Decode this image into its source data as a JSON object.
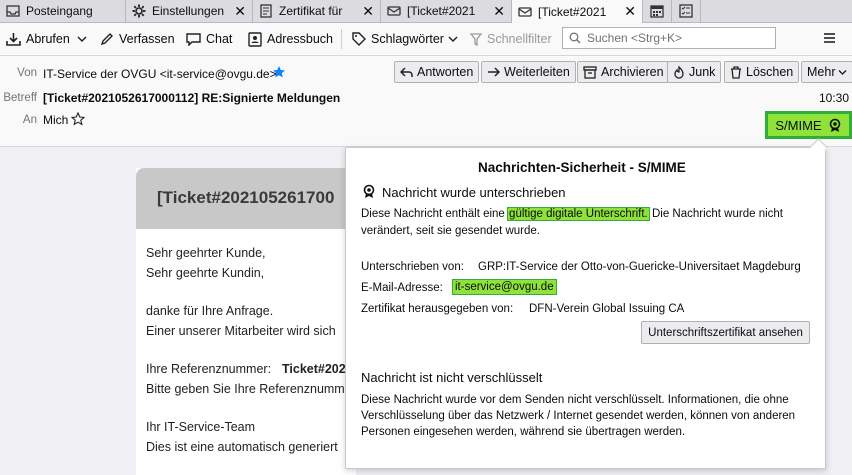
{
  "tabs": [
    {
      "label": "Posteingang",
      "icon": "inbox-icon"
    },
    {
      "label": "Einstellungen",
      "icon": "gear-icon"
    },
    {
      "label": "Zertifikat für",
      "icon": "document-icon"
    },
    {
      "label": "[Ticket#2021",
      "icon": "envelope-icon"
    },
    {
      "label": "[Ticket#2021",
      "icon": "envelope-icon"
    }
  ],
  "toolbar": {
    "abrufen": "Abrufen",
    "verfassen": "Verfassen",
    "chat": "Chat",
    "adressbuch": "Adressbuch",
    "schlagwoerter": "Schlagwörter",
    "schnellfilter": "Schnellfilter",
    "search_placeholder": "Suchen <Strg+K>",
    "menu_icon": "hamburger-icon"
  },
  "header": {
    "von_label": "Von",
    "von_value": "IT-Service der OVGU <it-service@ovgu.de>",
    "betreff_label": "Betreff",
    "betreff_value": "[Ticket#2021052617000112] RE:Signierte Meldungen",
    "an_label": "An",
    "an_value": "Mich",
    "time": "10:30",
    "buttons": {
      "antworten": "Antworten",
      "weiterleiten": "Weiterleiten",
      "archivieren": "Archivieren",
      "junk": "Junk",
      "loeschen": "Löschen",
      "mehr": "Mehr"
    },
    "smime": "S/MIME"
  },
  "message": {
    "title": "[Ticket#202105261700",
    "lines": [
      "Sehr geehrter Kunde,",
      "Sehr geehrte Kundin,",
      "danke für Ihre Anfrage.",
      "Einer unserer Mitarbeiter wird sich",
      "Ihre Referenznummer:",
      "Ticket#202",
      "Bitte geben Sie Ihre Referenznumm",
      "Ihr IT-Service-Team",
      "Dies ist eine automatisch generiert"
    ]
  },
  "panel": {
    "title": "Nachrichten-Sicherheit - S/MIME",
    "signed_heading": "Nachricht wurde unterschrieben",
    "signed_text_1": "Diese Nachricht enthält eine",
    "signed_highlight": "gültige digitale Unterschrift.",
    "signed_text_2": "Die Nachricht wurde nicht",
    "signed_text_3": "verändert, seit sie gesendet wurde.",
    "signer_label": "Unterschrieben von:",
    "signer_value": "GRP:IT-Service der Otto-von-Guericke-Universitaet Magdeburg",
    "email_label": "E-Mail-Adresse:",
    "email_value": "it-service@ovgu.de",
    "issuer_label": "Zertifikat herausgegeben von:",
    "issuer_value": "DFN-Verein Global Issuing CA",
    "cert_button": "Unterschriftszertifikat ansehen",
    "enc_heading": "Nachricht ist nicht verschlüsselt",
    "enc_line_1": "Diese Nachricht wurde vor dem Senden nicht verschlüsselt. Informationen, die ohne",
    "enc_line_2": "Verschlüsselung über das Netzwerk / Internet gesendet werden, können von anderen",
    "enc_line_3": "Personen eingesehen werden, während sie übertragen werden."
  },
  "colors": {
    "highlight": "#8ee23a",
    "highlight_border": "#2fae3a",
    "star": "#0a84ff"
  }
}
